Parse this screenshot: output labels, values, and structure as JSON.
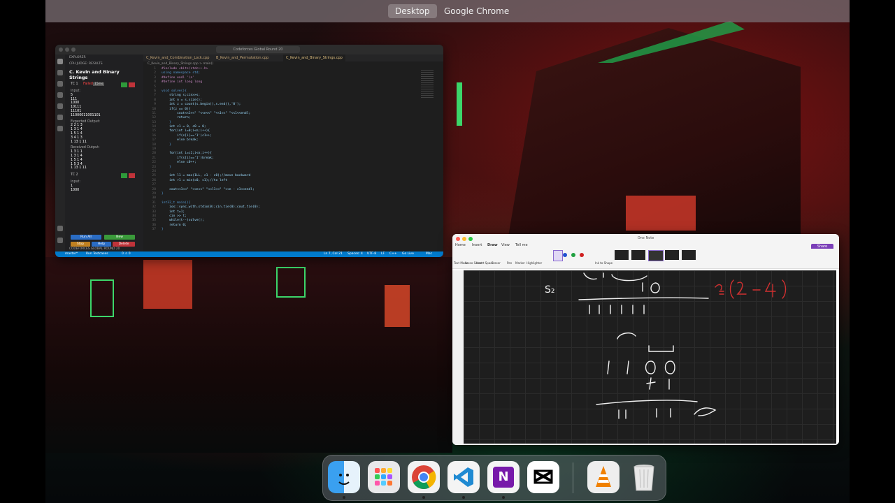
{
  "menubar": {
    "desktop": "Desktop",
    "chrome": "Google Chrome"
  },
  "vscode": {
    "window_title": "Codeforces Global Round 20",
    "tabs": [
      "C_Kevin_and_Combination_Lock.cpp",
      "B_Kevin_and_Permutation.cpp",
      "C_Kevin_and_Binary_Strings.cpp"
    ],
    "breadcrumb": "C_Kevin_and_Binary_Strings.cpp > main()",
    "sidebar": {
      "header": "EXPLORER",
      "section": "CPH JUDGE: RESULTS",
      "problem_title": "C. Kevin and Binary Strings",
      "tc1_label": "TC 1",
      "tc1_status": "Failed",
      "tc1_time": "15ms",
      "input_label": "Input:",
      "input_lines": [
        "5",
        "111",
        "1000",
        "10111",
        "11101",
        "11000011001101"
      ],
      "expected_label": "Expected Output:",
      "expected_lines": [
        "2 2 1 3",
        "1 3 1 4",
        "1 5 1 4",
        "3 4 1 3",
        "1 13 1 11"
      ],
      "received_label": "Received Output:",
      "received_lines": [
        "1 3 1 1",
        "1 3 1 4",
        "1 5 1 4",
        "1 5 3 4",
        "1 13 1 11"
      ],
      "tc2_label": "TC 2",
      "input2_label": "Input:",
      "input2_lines": [
        "1",
        "1000"
      ],
      "run_all": "Run All",
      "new": "New",
      "stop": "Stop",
      "help": "Help",
      "delete": "Delete",
      "footer_section": "CODEFORCES GLOBAL ROUND 20"
    },
    "code": [
      "#include <bits/stdc++.h>",
      "using namespace std;",
      "#define endl '\\n'",
      "#define int long long",
      "",
      "void solve(){",
      "    string s;cin>>s;",
      "    int n = s.size();",
      "    int z = count(s.begin(),s.end(),'0');",
      "    if(z == 0){",
      "        cout<<1<<\" \"<<n<<\" \"<<1<<\" \"<<1<<endl;",
      "        return;",
      "    }",
      "    int c1 = 0, c0 = 0;",
      "    for(int i=0;i<n;i++){",
      "        if(s[i]=='1')c1++;",
      "        else break;",
      "    }",
      "",
      "    for(int i=c1;i<n;i++){",
      "        if(s[i]=='1')break;",
      "        else c0++;",
      "    }",
      "",
      "    int l1 = max(1LL, c1 - c0);//move backward",
      "    int r1 = min(c0, c1);//to left",
      "",
      "    cout<<1<<\" \"<<n<<\" \"<<l1<<\" \"<<n - c1<<endl;",
      "}",
      "",
      "int32_t main(){",
      "    ios::sync_with_stdio(0);cin.tie(0);cout.tie(0);",
      "    int t=1;",
      "    cin >> t;",
      "    while(t--)solve();",
      "    return 0;",
      "}"
    ],
    "status": {
      "branch": "master*",
      "run": "Run Testcases",
      "errors": "0 ⚠ 0",
      "position": "Ln 7, Col 21",
      "spaces": "Spaces: 4",
      "encoding": "UTF-8",
      "eol": "LF",
      "lang": "C++",
      "golive": "Go Live",
      "platform": "Mac"
    }
  },
  "onenote": {
    "title": "One Note",
    "menu": [
      "Home",
      "Insert",
      "Draw",
      "View",
      "Tell me"
    ],
    "share": "Share",
    "ribbon": [
      "Text Mode",
      "Lasso Select",
      "Insert Space",
      "Eraser",
      "Pen",
      "Marker",
      "Highlighter",
      "Ink to Shape"
    ],
    "ink_label": "S₂"
  },
  "dock": {
    "apps": [
      "finder-icon",
      "launchpad-icon",
      "chrome-icon",
      "vscode-icon",
      "onenote-icon",
      "capcut-icon",
      "vlc-icon",
      "trash-icon"
    ]
  }
}
